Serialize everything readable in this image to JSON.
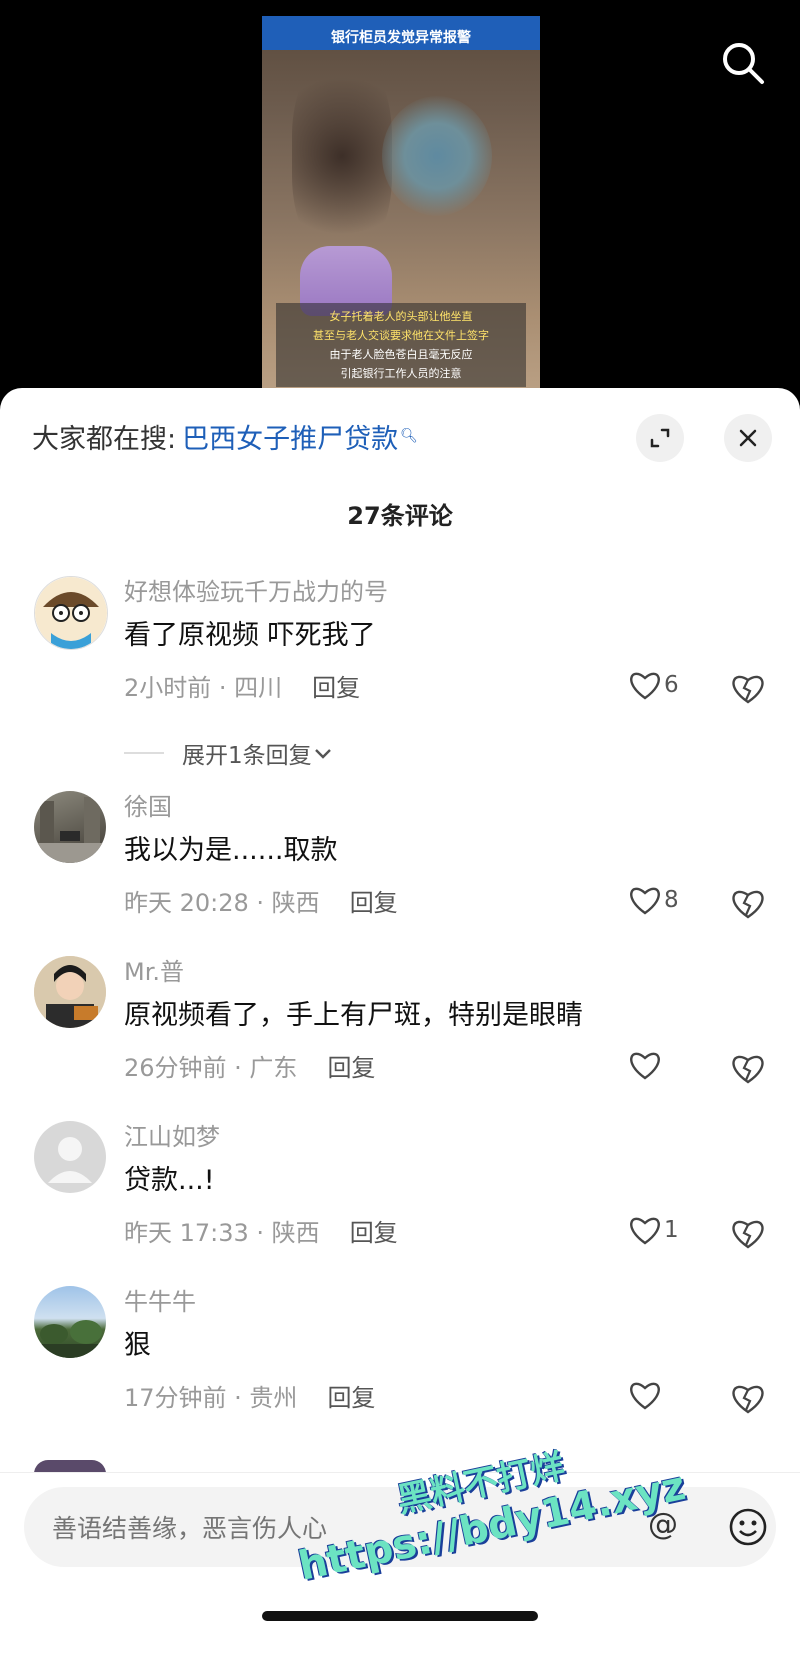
{
  "video": {
    "caption_top_line1": "",
    "caption_top_line2": "银行柜员发觉异常报警",
    "caption_bottom": [
      "女子托着老人的头部让他坐直",
      "甚至与老人交谈要求他在文件上签字",
      "由于老人脸色苍白且毫无反应",
      "引起银行工作人员的注意"
    ]
  },
  "sheet": {
    "search_prefix": "大家都在搜:",
    "search_term": "巴西女子推尸贷款",
    "comment_count": "27条评论"
  },
  "comments": [
    {
      "name": "好想体验玩千万战力的号",
      "text": "看了原视频 吓死我了",
      "time": "2小时前 · 四川",
      "reply": "回复",
      "likes": "6"
    },
    {
      "name": "徐国",
      "text": "我以为是......取款",
      "time": "昨天 20:28 · 陕西",
      "reply": "回复",
      "likes": "8"
    },
    {
      "name": "Mr.普",
      "text": "原视频看了，手上有尸斑，特别是眼睛",
      "time": "26分钟前 · 广东",
      "reply": "回复",
      "likes": ""
    },
    {
      "name": "江山如梦",
      "text": "贷款...!",
      "time": "昨天 17:33 · 陕西",
      "reply": "回复",
      "likes": "1"
    },
    {
      "name": "牛牛牛",
      "text": "狠",
      "time": "17分钟前 · 贵州",
      "reply": "回复",
      "likes": ""
    }
  ],
  "expand_replies": "展开1条回复",
  "input": {
    "placeholder": "善语结善缘，恶言伤人心"
  },
  "watermark": {
    "line1": "黑料不打烊",
    "line2": "https://bdy14.xyz"
  },
  "colors": {
    "link": "#1e5fb8",
    "muted": "#999999",
    "watermark": "#6ce3c2"
  }
}
